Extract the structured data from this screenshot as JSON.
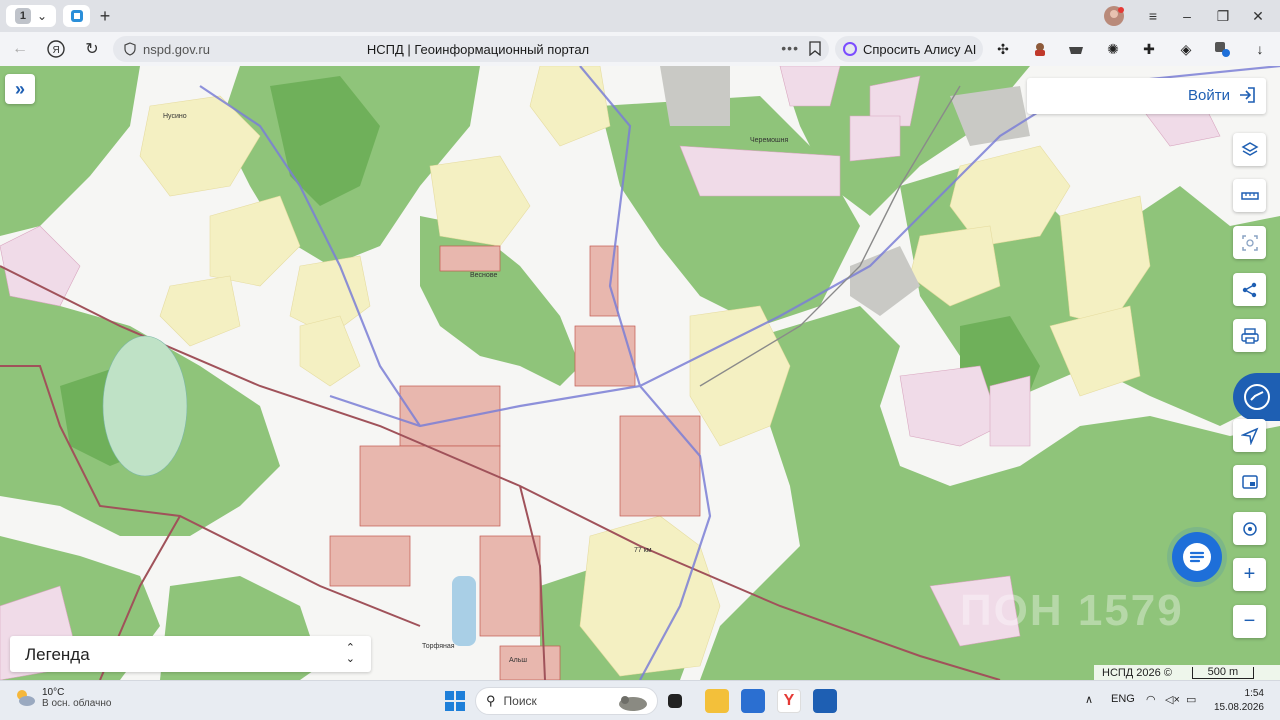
{
  "browser": {
    "tab_count": "1",
    "url": "nspd.gov.ru",
    "page_title": "НСПД | Геоинформационный портал",
    "alice_label": "Спросить Алису AI"
  },
  "map": {
    "login_label": "Войти",
    "legend_label": "Легенда",
    "attribution": "НСПД 2026 ©",
    "scale_label": "500 m",
    "watermark": "ПОН 1579",
    "place_labels": {
      "nusino": "Нусино",
      "chermoshnya": "Черемошня",
      "vesnovo": "Веснове",
      "km77": "77 км",
      "torfyanaya": "Торфяная",
      "alsh": "Альш"
    }
  },
  "taskbar": {
    "weather_temp": "10°C",
    "weather_desc": "В осн. облачно",
    "search_placeholder": "Поиск",
    "lang": "ENG",
    "time": "1:54",
    "date": "15.08.2026"
  },
  "colors": {
    "forest": "#8fc47a",
    "forest_dark": "#6fb05a",
    "field_yellow": "#f4f0c2",
    "pink_zone": "#f0dbe8",
    "accent_blue": "#1e5fb3",
    "road_brown": "#a0525a"
  }
}
